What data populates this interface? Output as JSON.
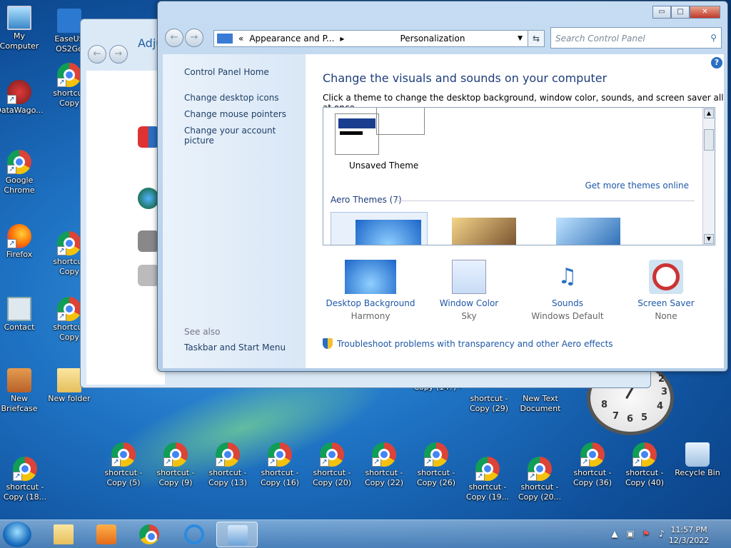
{
  "desktop": {
    "icons": [
      {
        "label": "My Computer"
      },
      {
        "label": "EaseUS OS2Go"
      },
      {
        "label": "shortcut Copy"
      },
      {
        "label": "DataWago..."
      },
      {
        "label": "Google Chrome"
      },
      {
        "label": "Firefox"
      },
      {
        "label": "shortcut Copy"
      },
      {
        "label": "Contact"
      },
      {
        "label": "shortcut Copy"
      },
      {
        "label": "New Briefcase"
      },
      {
        "label": "New folder"
      },
      {
        "label": "Copy (14?) -"
      },
      {
        "label": "shortcut - Copy (29)"
      },
      {
        "label": "New Text Document"
      },
      {
        "label": "shortcut - Copy (18..."
      },
      {
        "label": "shortcut - Copy (5)"
      },
      {
        "label": "shortcut - Copy (9)"
      },
      {
        "label": "shortcut - Copy (13)"
      },
      {
        "label": "shortcut - Copy (16)"
      },
      {
        "label": "shortcut - Copy (20)"
      },
      {
        "label": "shortcut - Copy (22)"
      },
      {
        "label": "shortcut - Copy (26)"
      },
      {
        "label": "shortcut - Copy (19..."
      },
      {
        "label": "shortcut - Copy (20..."
      },
      {
        "label": "shortcut - Copy (36)"
      },
      {
        "label": "shortcut - Copy (40)"
      },
      {
        "label": "Recycle Bin"
      }
    ],
    "clock_numbers": [
      "2",
      "3",
      "4",
      "5",
      "6",
      "7",
      "8"
    ]
  },
  "back_window": {
    "heading": "Adju"
  },
  "window": {
    "address": {
      "chevrons": "«",
      "crumb1": "Appearance and P...",
      "sep": "▸",
      "crumb2": "Personalization"
    },
    "search_placeholder": "Search Control Panel",
    "caption": {
      "min": "▭",
      "max": "□",
      "close": "✕"
    },
    "left_pane": {
      "home": "Control Panel Home",
      "links": [
        "Change desktop icons",
        "Change mouse pointers",
        "Change your account picture"
      ],
      "see_also": "See also",
      "see_also_links": [
        "Taskbar and Start Menu"
      ]
    },
    "main": {
      "heading": "Change the visuals and sounds on your computer",
      "subtitle": "Click a theme to change the desktop background, window color, sounds, and screen saver all at once.",
      "unsaved_theme": "Unsaved Theme",
      "get_more": "Get more themes online",
      "aero_group": "Aero Themes (7)",
      "options": [
        {
          "label": "Desktop Background",
          "value": "Harmony"
        },
        {
          "label": "Window Color",
          "value": "Sky"
        },
        {
          "label": "Sounds",
          "value": "Windows Default"
        },
        {
          "label": "Screen Saver",
          "value": "None"
        }
      ],
      "troubleshoot": "Troubleshoot problems with transparency and other Aero effects"
    }
  },
  "taskbar": {
    "time": "11:57 PM",
    "date": "12/3/2022"
  }
}
